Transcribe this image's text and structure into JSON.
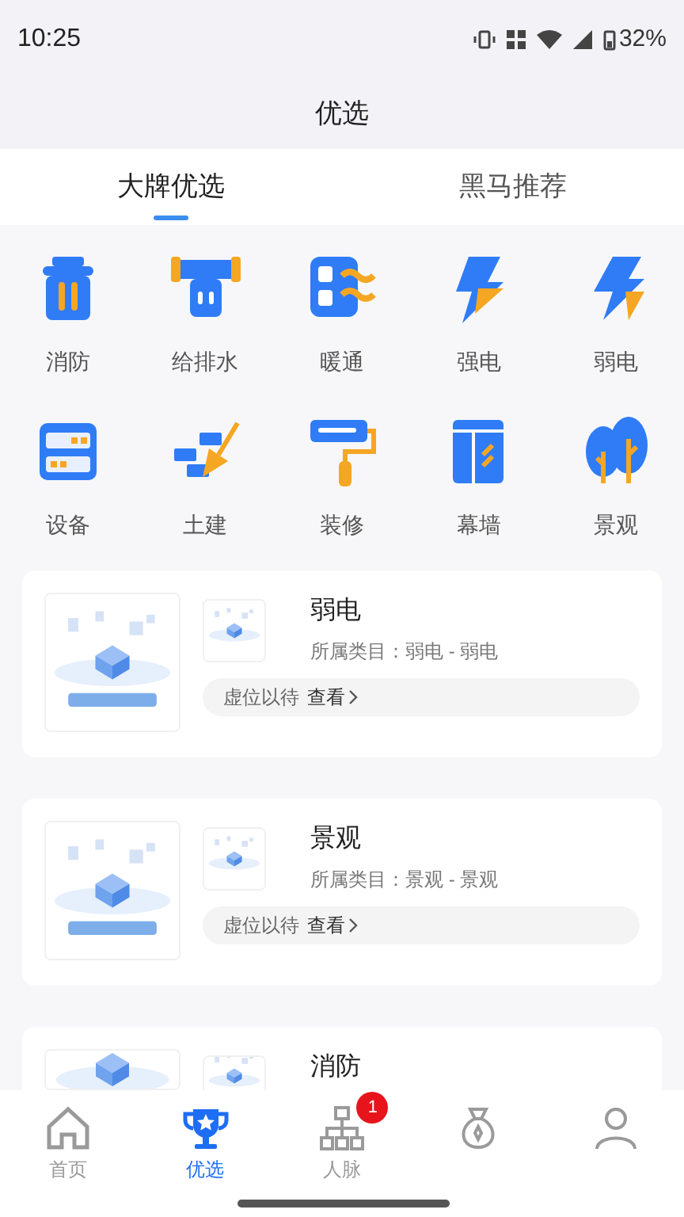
{
  "status_bar": {
    "time": "10:25",
    "battery": "32%"
  },
  "header": {
    "title": "优选"
  },
  "tabs": [
    {
      "label": "大牌优选",
      "selected": true
    },
    {
      "label": "黑马推荐",
      "selected": false
    }
  ],
  "categories": [
    {
      "label": "消防"
    },
    {
      "label": "给排水"
    },
    {
      "label": "暖通"
    },
    {
      "label": "强电"
    },
    {
      "label": "弱电"
    },
    {
      "label": "设备"
    },
    {
      "label": "土建"
    },
    {
      "label": "装修"
    },
    {
      "label": "幕墙"
    },
    {
      "label": "景观"
    }
  ],
  "cards": [
    {
      "title": "弱电",
      "category": "所属类目：弱电 - 弱电",
      "tag": "虚位以待",
      "link": "查看"
    },
    {
      "title": "景观",
      "category": "所属类目：景观 - 景观",
      "tag": "虚位以待",
      "link": "查看"
    },
    {
      "title": "消防"
    }
  ],
  "nav": [
    {
      "label": "首页",
      "selected": false
    },
    {
      "label": "优选",
      "selected": true
    },
    {
      "label": "人脉",
      "selected": false,
      "badge": "1"
    },
    {
      "selected": false
    },
    {
      "selected": false
    }
  ]
}
